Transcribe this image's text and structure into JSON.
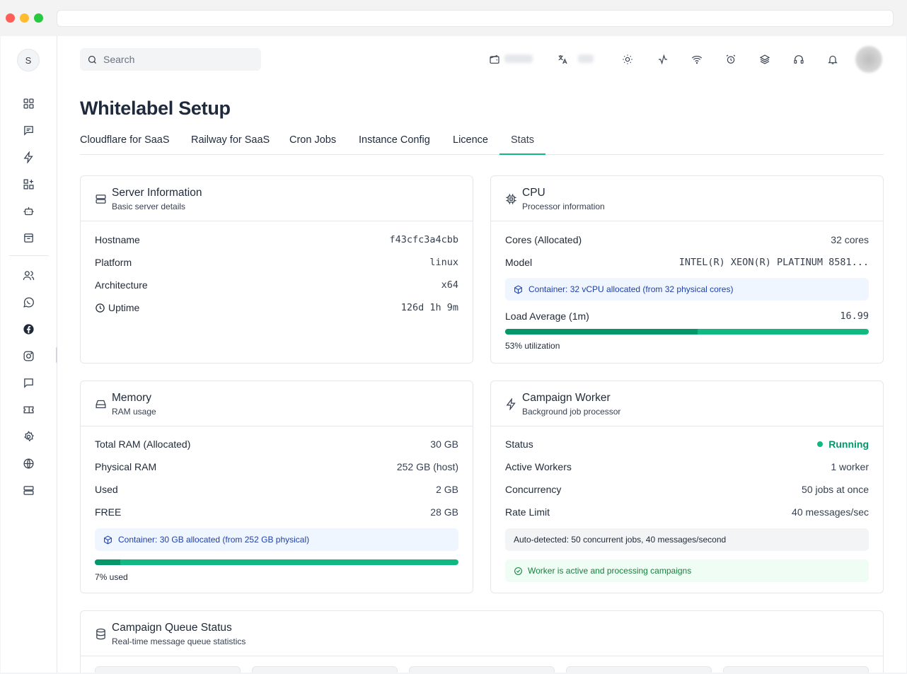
{
  "colors": {
    "accent": "#10b981",
    "title": "#1f2a3c",
    "info_blue": "#1e40af",
    "success": "#059669"
  },
  "sidebar": {
    "workspace_initial": "S",
    "icons": [
      "dashboard-icon",
      "message-square-icon",
      "zap-icon",
      "widgets-icon",
      "bot-icon",
      "inbox-icon",
      "users-icon",
      "whatsapp-icon",
      "facebook-icon",
      "instagram-icon",
      "chat-icon",
      "ticket-icon",
      "settings-icon",
      "globe-icon",
      "server-icon"
    ]
  },
  "topbar": {
    "search_placeholder": "Search",
    "icons": [
      "wallet-icon",
      "translate-icon",
      "sun-icon",
      "activity-icon",
      "wifi-icon",
      "alarm-icon",
      "layers-icon",
      "headphones-icon",
      "bell-icon"
    ]
  },
  "page": {
    "title": "Whitelabel Setup",
    "tabs": [
      "Cloudflare for SaaS",
      "Railway for SaaS",
      "Cron Jobs",
      "Instance Config",
      "Licence",
      "Stats"
    ],
    "active_tab": "Stats"
  },
  "server": {
    "title": "Server Information",
    "subtitle": "Basic server details",
    "rows": [
      {
        "label": "Hostname",
        "value": "f43cfc3a4cbb"
      },
      {
        "label": "Platform",
        "value": "linux"
      },
      {
        "label": "Architecture",
        "value": "x64"
      },
      {
        "label": "Uptime",
        "value": "126d 1h 9m"
      }
    ]
  },
  "cpu": {
    "title": "CPU",
    "subtitle": "Processor information",
    "cores_label": "Cores (Allocated)",
    "cores_value": "32 cores",
    "model_label": "Model",
    "model_value": "INTEL(R) XEON(R) PLATINUM 8581...",
    "container_note": "Container: 32 vCPU allocated (from 32 physical cores)",
    "load_label": "Load Average (1m)",
    "load_value": "16.99",
    "utilization_percent": 53,
    "utilization_text": "53% utilization"
  },
  "memory": {
    "title": "Memory",
    "subtitle": "RAM usage",
    "rows": [
      {
        "label": "Total RAM (Allocated)",
        "value": "30 GB"
      },
      {
        "label": "Physical RAM",
        "value": "252 GB (host)"
      },
      {
        "label": "Used",
        "value": "2 GB"
      },
      {
        "label": "FREE",
        "value": "28 GB"
      }
    ],
    "container_note": "Container: 30 GB allocated (from 252 GB physical)",
    "used_percent": 7,
    "used_text": "7% used"
  },
  "worker": {
    "title": "Campaign Worker",
    "subtitle": "Background job processor",
    "status_label": "Status",
    "status_value": "Running",
    "rows": [
      {
        "label": "Active Workers",
        "value": "1 worker"
      },
      {
        "label": "Concurrency",
        "value": "50 jobs at once"
      },
      {
        "label": "Rate Limit",
        "value": "40 messages/sec"
      }
    ],
    "auto_detected": "Auto-detected: 50 concurrent jobs, 40 messages/second",
    "active_note": "Worker is active and processing campaigns"
  },
  "queue": {
    "title": "Campaign Queue Status",
    "subtitle": "Real-time message queue statistics"
  }
}
